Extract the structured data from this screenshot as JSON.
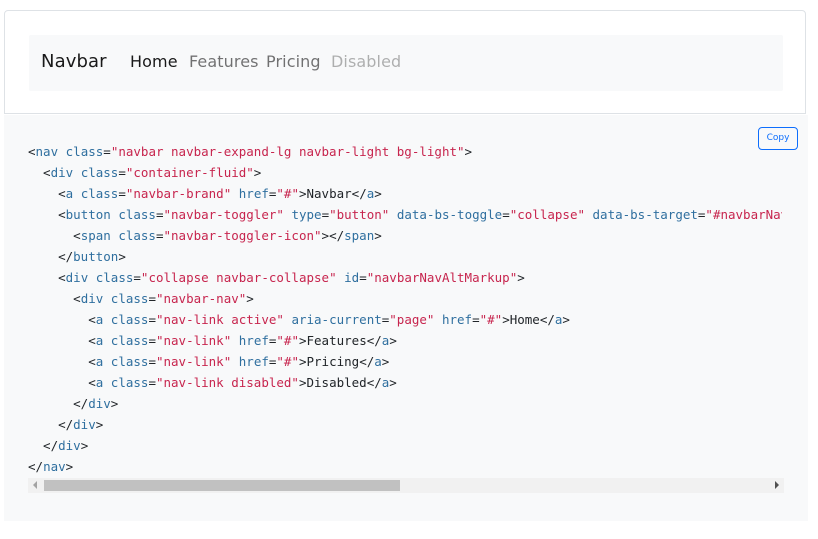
{
  "navbar": {
    "brand": "Navbar",
    "links": [
      {
        "label": "Home",
        "state": "active"
      },
      {
        "label": "Features",
        "state": "normal"
      },
      {
        "label": "Pricing",
        "state": "normal"
      },
      {
        "label": "Disabled",
        "state": "disabled"
      }
    ]
  },
  "code": {
    "copy_label": "Copy",
    "lines": [
      [
        [
          "p",
          "<"
        ],
        [
          "t",
          "nav"
        ],
        [
          "p",
          " "
        ],
        [
          "a",
          "class"
        ],
        [
          "p",
          "="
        ],
        [
          "v",
          "\"navbar navbar-expand-lg navbar-light bg-light\""
        ],
        [
          "p",
          ">"
        ]
      ],
      [
        [
          "p",
          "  <"
        ],
        [
          "t",
          "div"
        ],
        [
          "p",
          " "
        ],
        [
          "a",
          "class"
        ],
        [
          "p",
          "="
        ],
        [
          "v",
          "\"container-fluid\""
        ],
        [
          "p",
          ">"
        ]
      ],
      [
        [
          "p",
          "    <"
        ],
        [
          "t",
          "a"
        ],
        [
          "p",
          " "
        ],
        [
          "a",
          "class"
        ],
        [
          "p",
          "="
        ],
        [
          "v",
          "\"navbar-brand\""
        ],
        [
          "p",
          " "
        ],
        [
          "a",
          "href"
        ],
        [
          "p",
          "="
        ],
        [
          "v",
          "\"#\""
        ],
        [
          "p",
          ">Navbar</"
        ],
        [
          "t",
          "a"
        ],
        [
          "p",
          ">"
        ]
      ],
      [
        [
          "p",
          "    <"
        ],
        [
          "t",
          "button"
        ],
        [
          "p",
          " "
        ],
        [
          "a",
          "class"
        ],
        [
          "p",
          "="
        ],
        [
          "v",
          "\"navbar-toggler\""
        ],
        [
          "p",
          " "
        ],
        [
          "a",
          "type"
        ],
        [
          "p",
          "="
        ],
        [
          "v",
          "\"button\""
        ],
        [
          "p",
          " "
        ],
        [
          "a",
          "data-bs-toggle"
        ],
        [
          "p",
          "="
        ],
        [
          "v",
          "\"collapse\""
        ],
        [
          "p",
          " "
        ],
        [
          "a",
          "data-bs-target"
        ],
        [
          "p",
          "="
        ],
        [
          "v",
          "\"#navbarNavAltMarkup\""
        ]
      ],
      [
        [
          "p",
          "      <"
        ],
        [
          "t",
          "span"
        ],
        [
          "p",
          " "
        ],
        [
          "a",
          "class"
        ],
        [
          "p",
          "="
        ],
        [
          "v",
          "\"navbar-toggler-icon\""
        ],
        [
          "p",
          "></"
        ],
        [
          "t",
          "span"
        ],
        [
          "p",
          ">"
        ]
      ],
      [
        [
          "p",
          "    </"
        ],
        [
          "t",
          "button"
        ],
        [
          "p",
          ">"
        ]
      ],
      [
        [
          "p",
          "    <"
        ],
        [
          "t",
          "div"
        ],
        [
          "p",
          " "
        ],
        [
          "a",
          "class"
        ],
        [
          "p",
          "="
        ],
        [
          "v",
          "\"collapse navbar-collapse\""
        ],
        [
          "p",
          " "
        ],
        [
          "a",
          "id"
        ],
        [
          "p",
          "="
        ],
        [
          "v",
          "\"navbarNavAltMarkup\""
        ],
        [
          "p",
          ">"
        ]
      ],
      [
        [
          "p",
          "      <"
        ],
        [
          "t",
          "div"
        ],
        [
          "p",
          " "
        ],
        [
          "a",
          "class"
        ],
        [
          "p",
          "="
        ],
        [
          "v",
          "\"navbar-nav\""
        ],
        [
          "p",
          ">"
        ]
      ],
      [
        [
          "p",
          "        <"
        ],
        [
          "t",
          "a"
        ],
        [
          "p",
          " "
        ],
        [
          "a",
          "class"
        ],
        [
          "p",
          "="
        ],
        [
          "v",
          "\"nav-link active\""
        ],
        [
          "p",
          " "
        ],
        [
          "a",
          "aria-current"
        ],
        [
          "p",
          "="
        ],
        [
          "v",
          "\"page\""
        ],
        [
          "p",
          " "
        ],
        [
          "a",
          "href"
        ],
        [
          "p",
          "="
        ],
        [
          "v",
          "\"#\""
        ],
        [
          "p",
          ">Home</"
        ],
        [
          "t",
          "a"
        ],
        [
          "p",
          ">"
        ]
      ],
      [
        [
          "p",
          "        <"
        ],
        [
          "t",
          "a"
        ],
        [
          "p",
          " "
        ],
        [
          "a",
          "class"
        ],
        [
          "p",
          "="
        ],
        [
          "v",
          "\"nav-link\""
        ],
        [
          "p",
          " "
        ],
        [
          "a",
          "href"
        ],
        [
          "p",
          "="
        ],
        [
          "v",
          "\"#\""
        ],
        [
          "p",
          ">Features</"
        ],
        [
          "t",
          "a"
        ],
        [
          "p",
          ">"
        ]
      ],
      [
        [
          "p",
          "        <"
        ],
        [
          "t",
          "a"
        ],
        [
          "p",
          " "
        ],
        [
          "a",
          "class"
        ],
        [
          "p",
          "="
        ],
        [
          "v",
          "\"nav-link\""
        ],
        [
          "p",
          " "
        ],
        [
          "a",
          "href"
        ],
        [
          "p",
          "="
        ],
        [
          "v",
          "\"#\""
        ],
        [
          "p",
          ">Pricing</"
        ],
        [
          "t",
          "a"
        ],
        [
          "p",
          ">"
        ]
      ],
      [
        [
          "p",
          "        <"
        ],
        [
          "t",
          "a"
        ],
        [
          "p",
          " "
        ],
        [
          "a",
          "class"
        ],
        [
          "p",
          "="
        ],
        [
          "v",
          "\"nav-link disabled\""
        ],
        [
          "p",
          ">Disabled</"
        ],
        [
          "t",
          "a"
        ],
        [
          "p",
          ">"
        ]
      ],
      [
        [
          "p",
          "      </"
        ],
        [
          "t",
          "div"
        ],
        [
          "p",
          ">"
        ]
      ],
      [
        [
          "p",
          "    </"
        ],
        [
          "t",
          "div"
        ],
        [
          "p",
          ">"
        ]
      ],
      [
        [
          "p",
          "  </"
        ],
        [
          "t",
          "div"
        ],
        [
          "p",
          ">"
        ]
      ],
      [
        [
          "p",
          "</"
        ],
        [
          "t",
          "nav"
        ],
        [
          "p",
          ">"
        ]
      ]
    ]
  },
  "colors": {
    "tag": "#2f6f9f",
    "attr": "#2f6f9f",
    "value": "#c7254e",
    "accent": "#0d6efd"
  },
  "scrollbar": {
    "position_fraction": 0.0
  }
}
